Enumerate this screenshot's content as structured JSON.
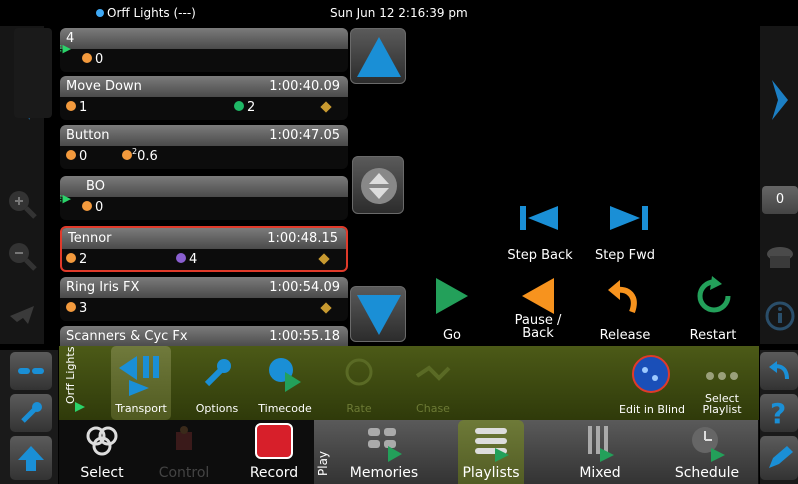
{
  "status": {
    "show_title": "Orff Lights (---)",
    "clock": "Sun Jun 12 2:16:39 pm"
  },
  "cues": [
    {
      "name": "4",
      "time": "",
      "items": [
        {
          "icon": "clock-icon",
          "value": "0"
        }
      ],
      "linked": true
    },
    {
      "name": "Move Down",
      "time": "1:00:40.09",
      "items": [
        {
          "icon": "clock-icon",
          "value": "1"
        },
        {
          "icon": "green-dot-icon",
          "value": "2"
        }
      ],
      "wand": true
    },
    {
      "name": "Button",
      "time": "1:00:47.05",
      "items": [
        {
          "icon": "clock-icon",
          "value": "0"
        },
        {
          "icon": "clock-icon",
          "value": "0.6",
          "sup": "2"
        }
      ]
    },
    {
      "name": "BO",
      "time": "",
      "items": [
        {
          "icon": "clock-icon",
          "value": "0"
        }
      ],
      "linked": true
    },
    {
      "name": "Tennor",
      "time": "1:00:48.15",
      "items": [
        {
          "icon": "clock-icon",
          "value": "2"
        },
        {
          "icon": "purple-dot-icon",
          "value": "4"
        }
      ],
      "wand": true,
      "selected": true
    },
    {
      "name": "Ring Iris FX",
      "time": "1:00:54.09",
      "items": [
        {
          "icon": "clock-icon",
          "value": "3"
        }
      ],
      "wand": true
    },
    {
      "name": "Scanners & Cyc Fx",
      "time": "1:00:55.18",
      "items": []
    }
  ],
  "transport": {
    "step_back": "Step Back",
    "step_fwd": "Step Fwd",
    "go": "Go",
    "pause_back": "Pause /\nBack",
    "release": "Release",
    "restart": "Restart"
  },
  "right_side": {
    "counter": "0"
  },
  "green_bar": {
    "section": "Orff Lights",
    "tabs": [
      "Transport",
      "Options",
      "Timecode",
      "Rate",
      "Chase"
    ],
    "active_tab": "Transport",
    "edit_in_blind": "Edit in Blind",
    "select_playlist": "Select Playlist"
  },
  "bottom_bar": {
    "select": "Select",
    "control": "Control",
    "record": "Record",
    "play_label": "Play",
    "tabs": [
      "Memories",
      "Playlists",
      "Mixed",
      "Schedule"
    ],
    "active_tab": "Playlists"
  },
  "colors": {
    "accent_green": "#2bd36a",
    "accent_blue": "#1a8fd6",
    "accent_orange": "#f39a3d",
    "selection_red": "#e03a2a",
    "toolbar_olive": "#4c5a17"
  }
}
